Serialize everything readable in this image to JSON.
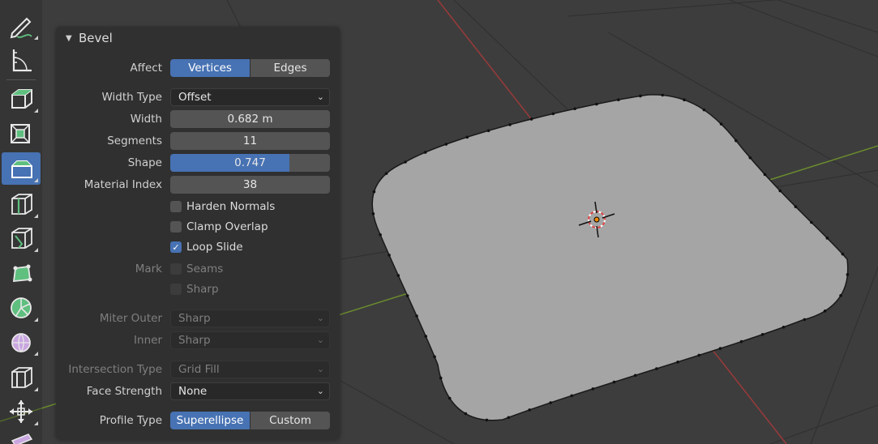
{
  "colors": {
    "accent": "#4772b3",
    "viewport_bg": "#3d3d3d",
    "panel_bg": "#303030",
    "face": "#a5a5a5",
    "axis_x": "#9a3a3a",
    "axis_y": "#6a8a2e"
  },
  "toolbar": {
    "tools": [
      {
        "icon": "annotate-icon"
      },
      {
        "icon": "measure-icon"
      },
      {
        "icon": "extrude-region-icon"
      },
      {
        "icon": "inset-faces-icon"
      },
      {
        "icon": "bevel-icon",
        "active": true
      },
      {
        "icon": "loop-cut-icon"
      },
      {
        "icon": "knife-icon"
      },
      {
        "icon": "poly-build-icon"
      },
      {
        "icon": "spin-icon"
      },
      {
        "icon": "smooth-icon"
      },
      {
        "icon": "edge-slide-icon"
      },
      {
        "icon": "shrink-fatten-icon"
      },
      {
        "icon": "shear-icon"
      }
    ]
  },
  "panel": {
    "title": "Bevel",
    "toggle": "▼",
    "affect": {
      "label": "Affect",
      "options": [
        "Vertices",
        "Edges"
      ],
      "selected": "Vertices"
    },
    "width_type": {
      "label": "Width Type",
      "value": "Offset"
    },
    "width": {
      "label": "Width",
      "value": "0.682 m"
    },
    "segments": {
      "label": "Segments",
      "value": "11"
    },
    "shape": {
      "label": "Shape",
      "value": "0.747",
      "fraction": 0.747
    },
    "material_index": {
      "label": "Material Index",
      "value": "38"
    },
    "harden_normals": {
      "label": "Harden Normals",
      "checked": false
    },
    "clamp_overlap": {
      "label": "Clamp Overlap",
      "checked": false
    },
    "loop_slide": {
      "label": "Loop Slide",
      "checked": true
    },
    "mark": {
      "label": "Mark",
      "seams": "Seams",
      "sharp": "Sharp"
    },
    "miter_outer": {
      "label": "Miter Outer",
      "value": "Sharp"
    },
    "inner": {
      "label": "Inner",
      "value": "Sharp"
    },
    "intersection_type": {
      "label": "Intersection Type",
      "value": "Grid Fill"
    },
    "face_strength": {
      "label": "Face Strength",
      "value": "None"
    },
    "profile_type": {
      "label": "Profile Type",
      "options": [
        "Superellipse",
        "Custom"
      ],
      "selected": "Superellipse"
    }
  }
}
